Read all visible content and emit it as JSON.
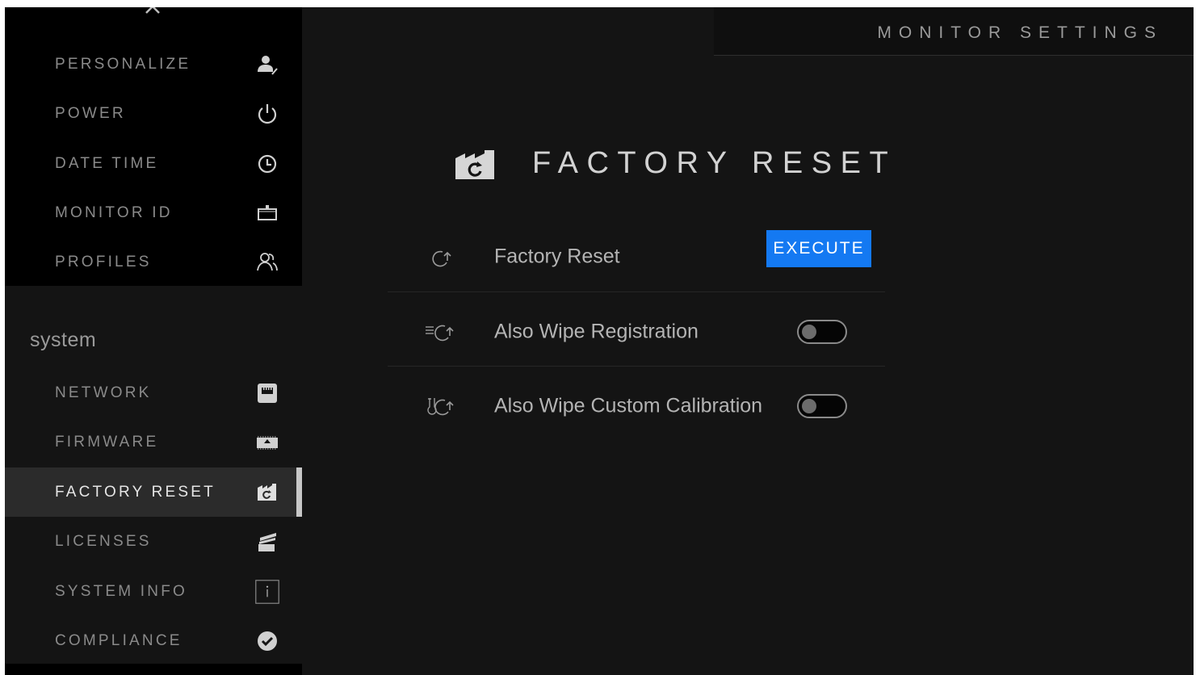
{
  "header": {
    "title": "MONITOR SETTINGS"
  },
  "sidebar": {
    "top_items": [
      {
        "label": "PERSONALIZE",
        "icon": "user-edit-icon"
      },
      {
        "label": "POWER",
        "icon": "power-icon"
      },
      {
        "label": "DATE TIME",
        "icon": "clock-icon"
      },
      {
        "label": "MONITOR ID",
        "icon": "id-tray-icon"
      },
      {
        "label": "PROFILES",
        "icon": "profiles-icon"
      }
    ],
    "section_label": "system",
    "system_items": [
      {
        "label": "NETWORK",
        "icon": "ethernet-port-icon"
      },
      {
        "label": "FIRMWARE",
        "icon": "firmware-chip-icon"
      },
      {
        "label": "FACTORY RESET",
        "icon": "factory-reset-icon",
        "active": true
      },
      {
        "label": "LICENSES",
        "icon": "licenses-cards-icon"
      },
      {
        "label": "SYSTEM INFO",
        "icon": "info-icon"
      },
      {
        "label": "COMPLIANCE",
        "icon": "check-circle-icon"
      }
    ]
  },
  "main": {
    "title": "FACTORY RESET",
    "title_icon": "factory-reset-icon",
    "rows": [
      {
        "label": "Factory Reset",
        "icon": "reset-arrow-icon",
        "control": "button",
        "button_label": "EXECUTE"
      },
      {
        "label": "Also Wipe Registration",
        "icon": "wipe-registration-icon",
        "control": "toggle",
        "value": false
      },
      {
        "label": "Also Wipe Custom Calibration",
        "icon": "wipe-calibration-icon",
        "control": "toggle",
        "value": false
      }
    ]
  },
  "colors": {
    "accent": "#1479f2",
    "background": "#141414",
    "sidebar_dark": "#000000",
    "active_item": "#2b2b2b"
  }
}
